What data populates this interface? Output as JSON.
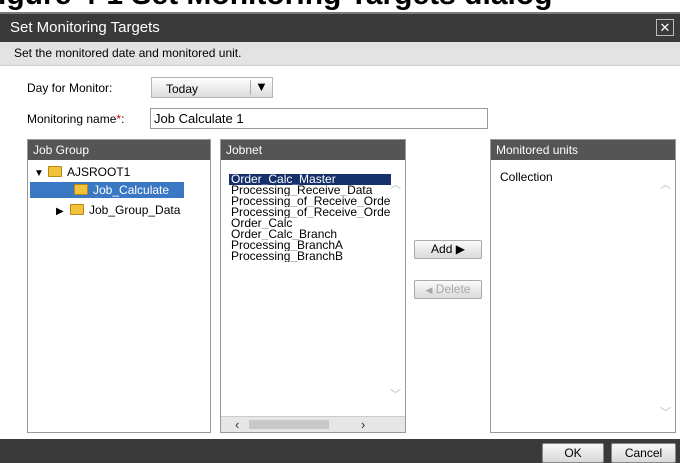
{
  "window": {
    "title": "Set Monitoring Targets",
    "close_glyph": "✕",
    "description": "Set the monitored date and monitored unit."
  },
  "top_strip_text": "igure 4-1 Set Monitoring Targets dialog",
  "form": {
    "day_label": "Day for Monitor:",
    "day_value": "Today",
    "name_label": "Monitoring name",
    "name_required": "*",
    "name_colon": ":",
    "name_value": "Job Calculate 1"
  },
  "job_group": {
    "header": "Job Group",
    "root": "AJSROOT1",
    "children": [
      "Job_Calculate",
      "Job_Group_Data"
    ],
    "selected": "Job_Calculate"
  },
  "jobnet": {
    "header": "Jobnet",
    "items": [
      "Order_Calc_Master",
      "Processing_Receive_Data",
      "Processing_of_Receive_Order",
      "Processing_of_Receive_Order",
      "Order_Calc",
      "Order_Calc_Branch",
      "Processing_BranchA",
      "Processing_BranchB"
    ],
    "selected_index": 0
  },
  "buttons": {
    "add": "Add",
    "delete": "Delete",
    "ok": "OK",
    "cancel": "Cancel"
  },
  "monitored_units": {
    "header": "Monitored units",
    "items": [
      "Collection"
    ]
  },
  "icons": {
    "expanded": "triangle-down-icon",
    "collapsed": "triangle-right-icon",
    "folder": "folder-icon",
    "add_arrow": "arrow-right-icon"
  },
  "colors": {
    "titlebar": "#3a3a3a",
    "panel_header": "#555555",
    "tree_selection": "#3a78c4",
    "list_selection": "#15306b",
    "folder": "#f3c23a"
  }
}
